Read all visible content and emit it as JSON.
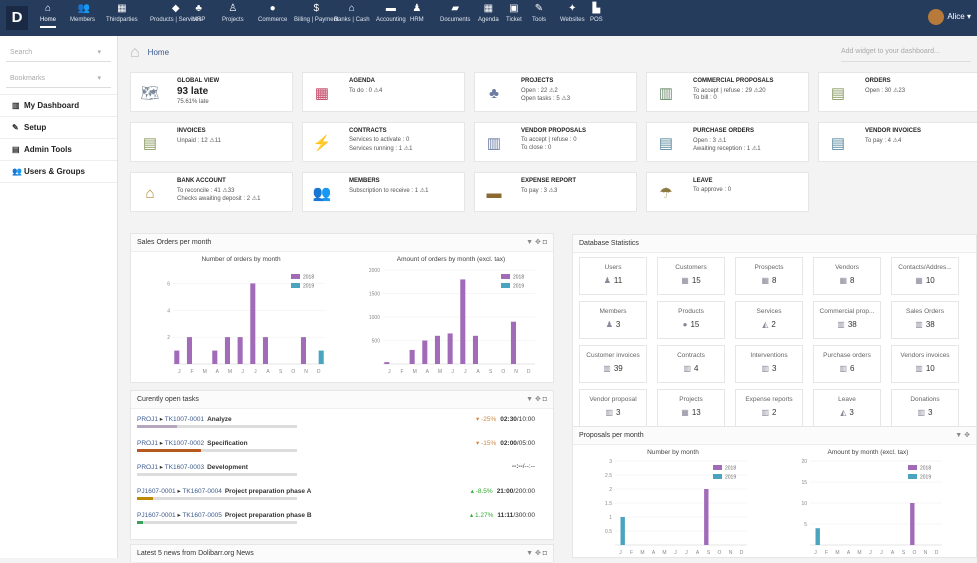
{
  "topbar": {
    "logo": "D",
    "menu": [
      {
        "label": "Home",
        "icon": "home-icon",
        "glyph": "⌂",
        "active": true
      },
      {
        "label": "Members",
        "icon": "members-icon",
        "glyph": "👥"
      },
      {
        "label": "Thirdparties",
        "icon": "building-icon",
        "glyph": "▦"
      },
      {
        "label": "Products | Services",
        "icon": "cube-icon",
        "glyph": "◆"
      },
      {
        "label": "MRP",
        "icon": "cubes-icon",
        "glyph": "♣"
      },
      {
        "label": "Projects",
        "icon": "sitemap-icon",
        "glyph": "♙"
      },
      {
        "label": "Commerce",
        "icon": "suitcase-icon",
        "glyph": "●"
      },
      {
        "label": "Billing | Payment",
        "icon": "money-icon",
        "glyph": "$"
      },
      {
        "label": "Banks | Cash",
        "icon": "bank-icon",
        "glyph": "⌂"
      },
      {
        "label": "Accounting",
        "icon": "accounting-icon",
        "glyph": "▬"
      },
      {
        "label": "HRM",
        "icon": "user-icon",
        "glyph": "♟"
      },
      {
        "label": "Documents",
        "icon": "folder-icon",
        "glyph": "▰"
      },
      {
        "label": "Agenda",
        "icon": "calendar-icon",
        "glyph": "▦"
      },
      {
        "label": "Ticket",
        "icon": "ticket-icon",
        "glyph": "▣"
      },
      {
        "label": "Tools",
        "icon": "wrench-icon",
        "glyph": "✎"
      },
      {
        "label": "Websites",
        "icon": "globe-icon",
        "glyph": "✦"
      },
      {
        "label": "POS",
        "icon": "cash-register-icon",
        "glyph": "▙"
      }
    ],
    "user": "Alice"
  },
  "sidebar": {
    "search_placeholder": "Search",
    "bookmarks_label": "Bookmarks",
    "links": [
      {
        "label": "My Dashboard",
        "icon": "chart-icon",
        "glyph": "▥"
      },
      {
        "label": "Setup",
        "icon": "wrench-icon",
        "glyph": "✎"
      },
      {
        "label": "Admin Tools",
        "icon": "tools-icon",
        "glyph": "▤"
      },
      {
        "label": "Users & Groups",
        "icon": "users-icon",
        "glyph": "👥"
      }
    ]
  },
  "breadcrumb": "Home",
  "add_widget_placeholder": "Add widget to your dashboard...",
  "boxes": [
    {
      "title": "GLOBAL VIEW",
      "icon": "globe-icon",
      "glyph": "🗺",
      "lines": [
        "93 late",
        "75.61% late"
      ],
      "color": "#7a8a9a"
    },
    {
      "title": "AGENDA",
      "icon": "calendar-icon",
      "glyph": "▦",
      "lines": [
        "To do : 0 ⚠4"
      ],
      "color": "#c04060"
    },
    {
      "title": "PROJECTS",
      "icon": "sitemap-icon",
      "glyph": "♣",
      "lines": [
        "Open : 22 ⚠2",
        "Open tasks : 5 ⚠3"
      ],
      "color": "#6a7aa0"
    },
    {
      "title": "COMMERCIAL PROPOSALS",
      "icon": "proposal-icon",
      "glyph": "▥",
      "lines": [
        "To accept | refuse : 29 ⚠20",
        "To bill : 0"
      ],
      "color": "#6a8a6a"
    },
    {
      "title": "ORDERS",
      "icon": "order-icon",
      "glyph": "▤",
      "lines": [
        "Open : 30 ⚠23"
      ],
      "color": "#8a9a60"
    },
    {
      "title": "INVOICES",
      "icon": "invoice-icon",
      "glyph": "▤",
      "lines": [
        "Unpaid : 12 ⚠11"
      ],
      "color": "#8a9a60"
    },
    {
      "title": "CONTRACTS",
      "icon": "plug-icon",
      "glyph": "⚡",
      "lines": [
        "Services to activate : 0",
        "Services running : 1 ⚠1"
      ],
      "color": "#6a9a4a"
    },
    {
      "title": "VENDOR PROPOSALS",
      "icon": "vendor-proposal-icon",
      "glyph": "▥",
      "lines": [
        "To accept | refuse : 0",
        "To close : 0"
      ],
      "color": "#6a7aa0"
    },
    {
      "title": "PURCHASE ORDERS",
      "icon": "purchase-order-icon",
      "glyph": "▤",
      "lines": [
        "Open : 3 ⚠1",
        "Awaiting reception : 1 ⚠1"
      ],
      "color": "#5a8aa0"
    },
    {
      "title": "VENDOR INVOICES",
      "icon": "vendor-invoice-icon",
      "glyph": "▤",
      "lines": [
        "To pay : 4 ⚠4"
      ],
      "color": "#5a8aa0"
    },
    {
      "title": "BANK ACCOUNT",
      "icon": "bank-icon",
      "glyph": "⌂",
      "lines": [
        "To reconcile : 41 ⚠33",
        "Checks awaiting deposit : 2 ⚠1"
      ],
      "color": "#b08a30"
    },
    {
      "title": "MEMBERS",
      "icon": "members-icon",
      "glyph": "👥",
      "lines": [
        "Subscription to receive : 1 ⚠1"
      ],
      "color": "#8a7a9a"
    },
    {
      "title": "EXPENSE REPORT",
      "icon": "wallet-icon",
      "glyph": "▬",
      "lines": [
        "To pay : 3 ⚠3"
      ],
      "color": "#8a6a30"
    },
    {
      "title": "LEAVE",
      "icon": "beach-icon",
      "glyph": "☂",
      "lines": [
        "To approve : 0"
      ],
      "color": "#8a7a40"
    }
  ],
  "sales_panel": {
    "title": "Sales Orders per month",
    "tools": "▼ ✥ ◘"
  },
  "tasks_panel": {
    "title": "Curently open tasks",
    "tools": "▼ ✥ ◘",
    "tasks": [
      {
        "project": "PROJ1",
        "task": "TK1007-0001",
        "name": "Analyze",
        "delta": "▾ -25%",
        "time": "02:30",
        "planned": "/10:00",
        "delta_class": "red",
        "fill": 25,
        "color": "#b6a6c0"
      },
      {
        "project": "PROJ1",
        "task": "TK1007-0002",
        "name": "Specification",
        "delta": "▾ -15%",
        "time": "02:00",
        "planned": "/05:00",
        "delta_class": "red",
        "fill": 40,
        "color": "#b75a20"
      },
      {
        "project": "PROJ1",
        "task": "TK1607-0003",
        "name": "Development",
        "delta": "",
        "time": "--:--",
        "planned": "/--:--",
        "delta_class": "",
        "fill": 0,
        "color": "#ccc"
      },
      {
        "project": "PJ1607-0001",
        "task": "TK1607-0004",
        "name": "Project preparation phase A",
        "delta": "▴ -8.5%",
        "time": "21:00",
        "planned": "/200:00",
        "delta_class": "green",
        "fill": 10,
        "color": "#c08a00"
      },
      {
        "project": "PJ1607-0001",
        "task": "TK1607-0005",
        "name": "Project preparation phase B",
        "delta": "▴ 1.27%",
        "time": "11:11",
        "planned": "/300:00",
        "delta_class": "green",
        "fill": 4,
        "color": "#3aa060"
      }
    ]
  },
  "news_panel": {
    "title": "Latest 5 news from Dolibarr.org News",
    "tools": "▼ ✥ ◘"
  },
  "stats_panel": {
    "title": "Database Statistics",
    "items": [
      {
        "label": "Users",
        "value": "11",
        "icon": "user-icon",
        "glyph": "♟"
      },
      {
        "label": "Customers",
        "value": "15",
        "icon": "customer-icon",
        "glyph": "▦"
      },
      {
        "label": "Prospects",
        "value": "8",
        "icon": "prospect-icon",
        "glyph": "▦"
      },
      {
        "label": "Vendors",
        "value": "8",
        "icon": "vendor-icon",
        "glyph": "▦"
      },
      {
        "label": "Contacts/Addres...",
        "value": "10",
        "icon": "contact-icon",
        "glyph": "▦"
      },
      {
        "label": "Members",
        "value": "3",
        "icon": "member-icon",
        "glyph": "♟"
      },
      {
        "label": "Products",
        "value": "15",
        "icon": "product-icon",
        "glyph": "●"
      },
      {
        "label": "Services",
        "value": "2",
        "icon": "service-icon",
        "glyph": "◭"
      },
      {
        "label": "Commercial prop...",
        "value": "38",
        "icon": "proposal-icon",
        "glyph": "▥"
      },
      {
        "label": "Sales Orders",
        "value": "38",
        "icon": "order-icon",
        "glyph": "▥"
      },
      {
        "label": "Customer invoices",
        "value": "39",
        "icon": "invoice-icon",
        "glyph": "▥"
      },
      {
        "label": "Contracts",
        "value": "4",
        "icon": "contract-icon",
        "glyph": "▥"
      },
      {
        "label": "Interventions",
        "value": "3",
        "icon": "intervention-icon",
        "glyph": "▥"
      },
      {
        "label": "Purchase orders",
        "value": "6",
        "icon": "purchase-order-icon",
        "glyph": "▥"
      },
      {
        "label": "Vendors invoices",
        "value": "10",
        "icon": "vendor-invoice-icon",
        "glyph": "▥"
      },
      {
        "label": "Vendor proposal",
        "value": "3",
        "icon": "vendor-proposal-icon",
        "glyph": "▥"
      },
      {
        "label": "Projects",
        "value": "13",
        "icon": "project-icon",
        "glyph": "▦"
      },
      {
        "label": "Expense reports",
        "value": "2",
        "icon": "expense-icon",
        "glyph": "▥"
      },
      {
        "label": "Leave",
        "value": "3",
        "icon": "leave-icon",
        "glyph": "◭"
      },
      {
        "label": "Donations",
        "value": "3",
        "icon": "donation-icon",
        "glyph": "▥"
      }
    ]
  },
  "proposals_panel": {
    "title": "Proposals per month",
    "tools": "▼ ✥"
  },
  "chart_data": [
    {
      "type": "bar",
      "title": "Number of orders by month",
      "xlabel": "",
      "ylabel": "",
      "categories": [
        "J",
        "F",
        "M",
        "A",
        "M",
        "J",
        "J",
        "A",
        "S",
        "O",
        "N",
        "D"
      ],
      "ylim": [
        0,
        7
      ],
      "yticks": [
        2,
        4,
        6
      ],
      "series": [
        {
          "name": "2018",
          "color": "#a26bb8",
          "values": [
            1,
            2,
            0,
            1,
            2,
            2,
            6,
            2,
            0,
            0,
            2,
            0
          ]
        },
        {
          "name": "2019",
          "color": "#4aa4c0",
          "values": [
            0,
            0,
            0,
            0,
            0,
            0,
            0,
            0,
            0,
            0,
            0,
            1
          ]
        }
      ]
    },
    {
      "type": "bar",
      "title": "Amount of orders by month (excl. tax)",
      "xlabel": "",
      "ylabel": "",
      "categories": [
        "J",
        "F",
        "M",
        "A",
        "M",
        "J",
        "J",
        "A",
        "S",
        "O",
        "N",
        "D"
      ],
      "ylim": [
        0,
        2000
      ],
      "yticks": [
        500,
        1000,
        1500,
        2000
      ],
      "series": [
        {
          "name": "2018",
          "color": "#a26bb8",
          "values": [
            40,
            0,
            300,
            500,
            600,
            650,
            1800,
            600,
            0,
            0,
            900,
            0
          ]
        },
        {
          "name": "2019",
          "color": "#4aa4c0",
          "values": [
            0,
            0,
            0,
            0,
            0,
            0,
            0,
            0,
            0,
            0,
            0,
            0
          ]
        }
      ]
    },
    {
      "type": "bar",
      "title": "Number by month",
      "xlabel": "",
      "ylabel": "",
      "categories": [
        "J",
        "F",
        "M",
        "A",
        "M",
        "J",
        "J",
        "A",
        "S",
        "O",
        "N",
        "D"
      ],
      "ylim": [
        0,
        3
      ],
      "yticks": [
        0.5,
        1,
        1.5,
        2,
        2.5,
        3
      ],
      "series": [
        {
          "name": "2018",
          "color": "#a26bb8",
          "values": [
            0,
            0,
            0,
            0,
            0,
            0,
            0,
            0,
            2,
            0,
            0,
            0
          ]
        },
        {
          "name": "2019",
          "color": "#4aa4c0",
          "values": [
            1,
            0,
            0,
            0,
            0,
            0,
            0,
            0,
            0,
            0,
            0,
            0
          ]
        }
      ]
    },
    {
      "type": "bar",
      "title": "Amount by month (excl. tax)",
      "xlabel": "",
      "ylabel": "",
      "categories": [
        "J",
        "F",
        "M",
        "A",
        "M",
        "J",
        "J",
        "A",
        "S",
        "O",
        "N",
        "D"
      ],
      "ylim": [
        0,
        20
      ],
      "yticks": [
        5,
        10,
        15,
        20
      ],
      "series": [
        {
          "name": "2018",
          "color": "#a26bb8",
          "values": [
            0,
            0,
            0,
            0,
            0,
            0,
            0,
            0,
            0,
            10,
            0,
            0
          ]
        },
        {
          "name": "2019",
          "color": "#4aa4c0",
          "values": [
            4,
            0,
            0,
            0,
            0,
            0,
            0,
            0,
            0,
            0,
            0,
            0
          ]
        }
      ]
    }
  ]
}
